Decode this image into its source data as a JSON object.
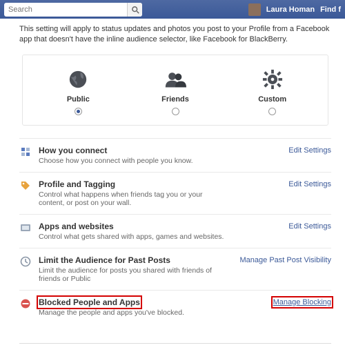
{
  "topbar": {
    "search_placeholder": "Search",
    "user_name": "Laura Homan",
    "find_friends": "Find f"
  },
  "intro": "This setting will apply to status updates and photos you post to your Profile from a Facebook app that doesn't have the inline audience selector, like Facebook for BlackBerry.",
  "audience": {
    "options": [
      {
        "label": "Public",
        "selected": true
      },
      {
        "label": "Friends",
        "selected": false
      },
      {
        "label": "Custom",
        "selected": false
      }
    ]
  },
  "sections": [
    {
      "title": "How you connect",
      "desc": "Choose how you connect with people you know.",
      "link": "Edit Settings"
    },
    {
      "title": "Profile and Tagging",
      "desc": "Control what happens when friends tag you or your content, or post on your wall.",
      "link": "Edit Settings"
    },
    {
      "title": "Apps and websites",
      "desc": "Control what gets shared with apps, games and websites.",
      "link": "Edit Settings"
    },
    {
      "title": "Limit the Audience for Past Posts",
      "desc": "Limit the audience for posts you shared with friends of friends or Public",
      "link": "Manage Past Post Visibility"
    },
    {
      "title": "Blocked People and Apps",
      "desc": "Manage the people and apps you've blocked.",
      "link": "Manage Blocking"
    }
  ]
}
